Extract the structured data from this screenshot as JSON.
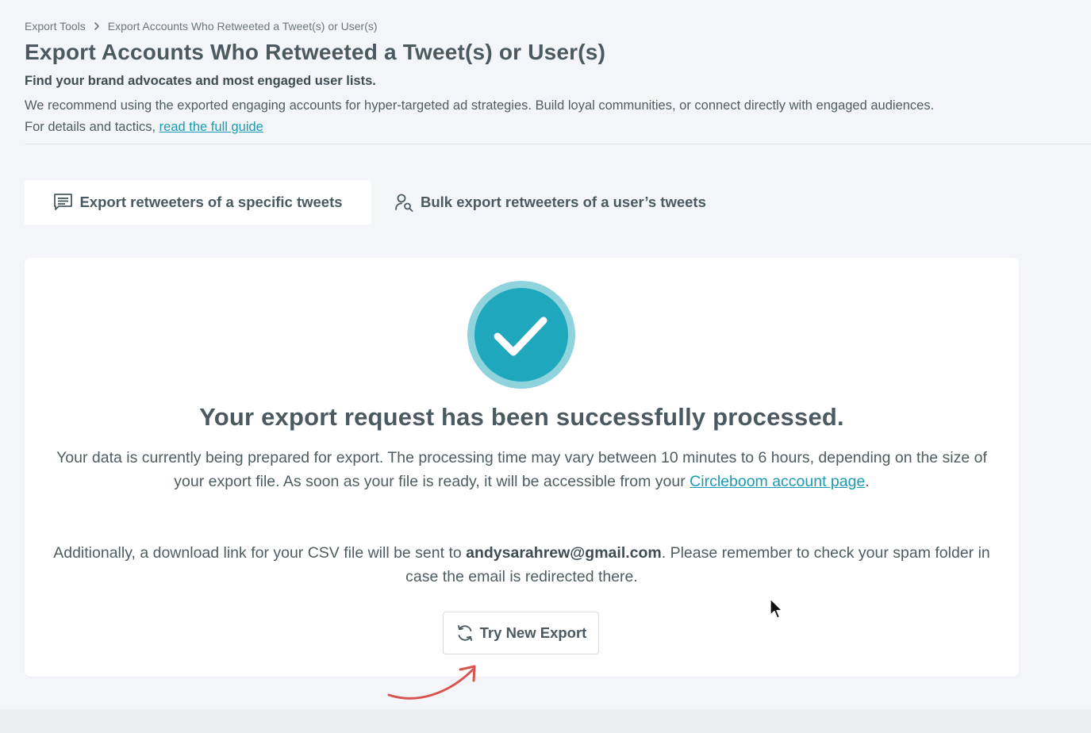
{
  "breadcrumb": {
    "root": "Export Tools",
    "current": "Export Accounts Who Retweeted a Tweet(s) or User(s)"
  },
  "header": {
    "title": "Export Accounts Who Retweeted a Tweet(s) or User(s)",
    "subtitle": "Find your brand advocates and most engaged user lists.",
    "description_line1": "We recommend using the exported engaging accounts for hyper-targeted ad strategies. Build loyal communities, or connect directly with engaged audiences.",
    "description_line2_prefix": "For details and tactics, ",
    "guide_link": "read the full guide"
  },
  "tabs": [
    {
      "label": "Export retweeters of a specific tweets",
      "icon": "message-list-icon",
      "active": true
    },
    {
      "label": "Bulk export retweeters of a user’s tweets",
      "icon": "user-search-icon",
      "active": false
    }
  ],
  "result": {
    "icon": "check-circle-icon",
    "heading": "Your export request has been successfully processed.",
    "para1_text": "Your data is currently being prepared for export. The processing time may vary between 10 minutes to 6 hours, depending on the size of your export file. As soon as your file is ready, it will be accessible from your ",
    "para1_link": "Circleboom account page",
    "para1_end": ".",
    "para2_prefix": "Additionally, a download link for your CSV file will be sent to ",
    "email": "andysarahrew@gmail.com",
    "para2_suffix": ". Please remember to check your spam folder in case the email is redirected there.",
    "button_label": "Try New Export",
    "button_icon": "refresh-icon"
  },
  "colors": {
    "accent": "#1fa7bd",
    "accent_ring": "#8fd3dd",
    "link": "#1a9bb3",
    "arrow": "#d9534f",
    "text": "#4a5a60",
    "background": "#f4f5f8"
  }
}
